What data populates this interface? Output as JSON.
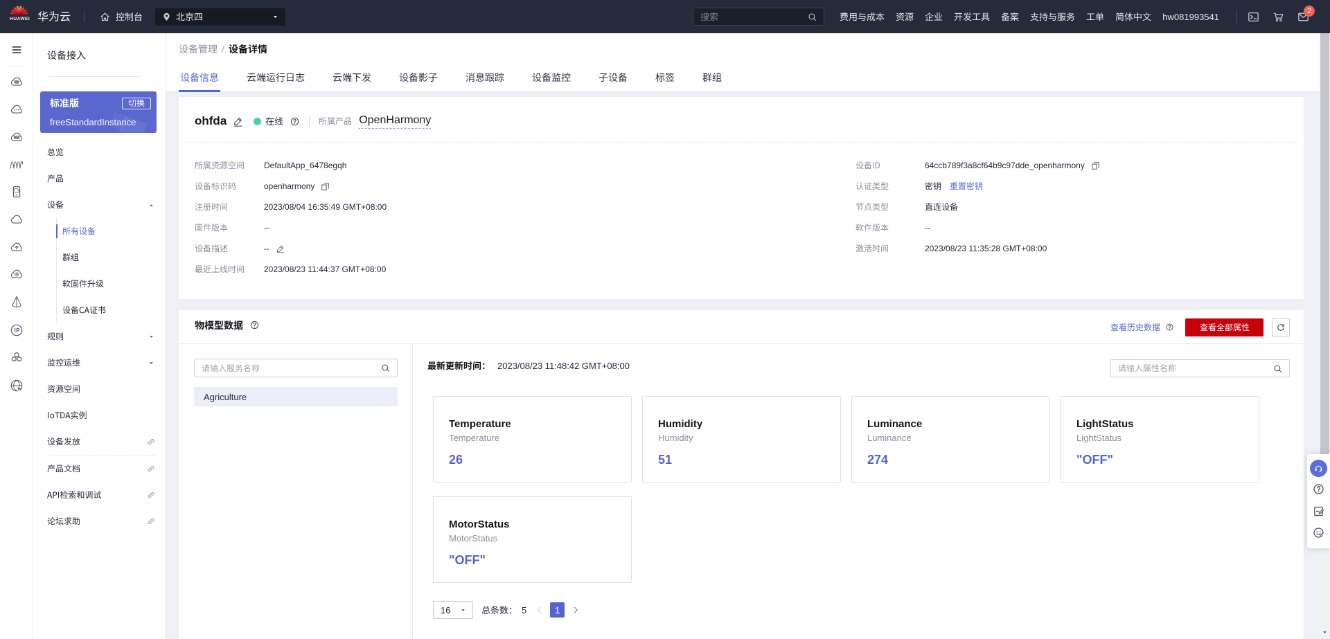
{
  "topbar": {
    "brand": "华为云",
    "brand_en": "HUAWEI",
    "console": "控制台",
    "region": "北京四",
    "search_placeholder": "搜索",
    "menu": [
      {
        "label": "费用与成本"
      },
      {
        "label": "资源"
      },
      {
        "label": "企业"
      },
      {
        "label": "开发工具"
      },
      {
        "label": "备案"
      },
      {
        "label": "支持与服务"
      },
      {
        "label": "工单"
      },
      {
        "label": "简体中文"
      }
    ],
    "account": "hw081993541",
    "mail_badge": "2"
  },
  "sidebar": {
    "title": "设备接入",
    "instance": {
      "edition": "标准版",
      "switch_label": "切换",
      "name": "freeStandardInstance"
    },
    "nav": [
      {
        "label": "总览"
      },
      {
        "label": "产品"
      },
      {
        "label": "设备",
        "state": "expanded"
      },
      {
        "label": "所有设备",
        "child": true,
        "active": true
      },
      {
        "label": "群组",
        "child": true
      },
      {
        "label": "软固件升级",
        "child": true
      },
      {
        "label": "设备CA证书",
        "child": true
      },
      {
        "label": "规则",
        "state": "collapsed"
      },
      {
        "label": "监控运维",
        "state": "collapsed"
      },
      {
        "label": "资源空间"
      },
      {
        "label": "IoTDA实例"
      },
      {
        "label": "设备发放",
        "external": true
      },
      {
        "label": "产品文档",
        "external": true
      },
      {
        "label": "API检索和调试",
        "external": true
      },
      {
        "label": "论坛求助",
        "external": true
      }
    ]
  },
  "breadcrumb": {
    "parent": "设备管理",
    "separator": "/",
    "current": "设备详情"
  },
  "tabs": [
    {
      "label": "设备信息",
      "active": true
    },
    {
      "label": "云端运行日志"
    },
    {
      "label": "云端下发"
    },
    {
      "label": "设备影子"
    },
    {
      "label": "消息跟踪"
    },
    {
      "label": "设备监控"
    },
    {
      "label": "子设备"
    },
    {
      "label": "标签"
    },
    {
      "label": "群组"
    }
  ],
  "device": {
    "name": "ohfda",
    "status": "在线",
    "product_label": "所属产品",
    "product": "OpenHarmony",
    "fields_left": [
      {
        "label": "所属资源空间",
        "value": "DefaultApp_6478egqh"
      },
      {
        "label": "设备标识码",
        "value": "openharmony",
        "copy": true
      },
      {
        "label": "注册时间",
        "value": "2023/08/04 16:35:49 GMT+08:00"
      },
      {
        "label": "固件版本",
        "value": "--"
      },
      {
        "label": "设备描述",
        "value": "--",
        "editable": true
      },
      {
        "label": "最近上线时间",
        "value": "2023/08/23 11:44:37 GMT+08:00"
      }
    ],
    "fields_right": [
      {
        "label": "设备ID",
        "value": "64ccb789f3a8cf64b9c97dde_openharmony",
        "copy": true
      },
      {
        "label": "认证类型",
        "value": "密钥",
        "link": "重置密钥"
      },
      {
        "label": "节点类型",
        "value": "直连设备"
      },
      {
        "label": "软件版本",
        "value": "--"
      },
      {
        "label": "激活时间",
        "value": "2023/08/23 11:35:28 GMT+08:00"
      }
    ]
  },
  "model_section": {
    "title": "物模型数据",
    "history_link": "查看历史数据",
    "view_all_button": "查看全部属性",
    "service_search_placeholder": "请输入服务名称",
    "services": [
      {
        "name": "Agriculture",
        "selected": true
      }
    ],
    "latest_label": "最新更新时间：",
    "latest_time": "2023/08/23 11:48:42 GMT+08:00",
    "prop_search_placeholder": "请输入属性名称",
    "properties": [
      {
        "title": "Temperature",
        "subtitle": "Temperature",
        "value": "26"
      },
      {
        "title": "Humidity",
        "subtitle": "Humidity",
        "value": "51"
      },
      {
        "title": "Luminance",
        "subtitle": "Luminance",
        "value": "274"
      },
      {
        "title": "LightStatus",
        "subtitle": "LightStatus",
        "value": "\"OFF\""
      },
      {
        "title": "MotorStatus",
        "subtitle": "MotorStatus",
        "value": "\"OFF\""
      }
    ],
    "pagination": {
      "page_size": "16",
      "total_label": "总条数：",
      "total": "5",
      "page": "1"
    }
  },
  "colors": {
    "accent": "#5565cf",
    "brand_red": "#c7000b",
    "online_green": "#4fd0a2",
    "topbar_bg": "#252b3a",
    "page_bg": "#eef0f5"
  }
}
